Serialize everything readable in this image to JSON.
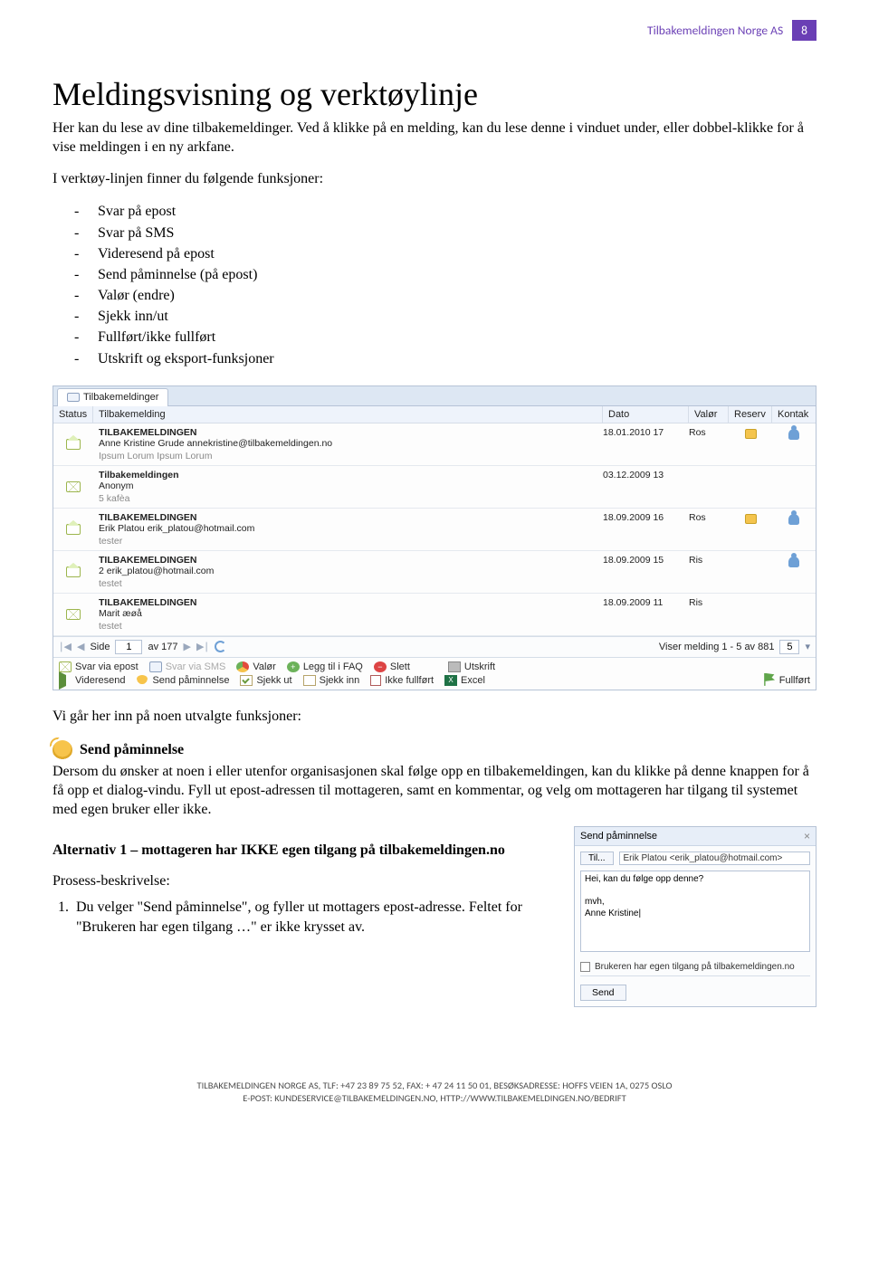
{
  "header": {
    "label": "Tilbakemeldingen Norge AS",
    "page": "8"
  },
  "title": "Meldingsvisning og verktøylinje",
  "intro1": "Her kan du lese av dine tilbakemeldinger. Ved å klikke på en melding, kan du lese denne i vinduet under, eller dobbel-klikke for å vise meldingen i en ny arkfane.",
  "intro2": "I verktøy-linjen finner du følgende funksjoner:",
  "bullets": [
    "Svar på epost",
    "Svar på SMS",
    "Videresend på epost",
    "Send påminnelse (på epost)",
    "Valør (endre)",
    "Sjekk inn/ut",
    "Fullført/ikke fullført",
    "Utskrift og eksport-funksjoner"
  ],
  "app": {
    "tab": "Tilbakemeldinger",
    "columns": {
      "status": "Status",
      "tilbakemelding": "Tilbakemelding",
      "dato": "Dato",
      "valor": "Valør",
      "reserv": "Reserv",
      "kontak": "Kontak"
    },
    "rows": [
      {
        "title": "TILBAKEMELDINGEN",
        "from": "Anne Kristine Grude annekristine@tilbakemeldingen.no",
        "snippet": "Ipsum Lorum Ipsum Lorum",
        "dato": "18.01.2010 17",
        "valor": "Ros",
        "reserv": true,
        "kontak": true,
        "open": true
      },
      {
        "title": "Tilbakemeldingen",
        "from": "Anonym",
        "snippet": "5 kafèa",
        "dato": "03.12.2009 13",
        "valor": "",
        "reserv": false,
        "kontak": false,
        "open": false
      },
      {
        "title": "TILBAKEMELDINGEN",
        "from": "Erik Platou erik_platou@hotmail.com",
        "snippet": "tester",
        "dato": "18.09.2009 16",
        "valor": "Ros",
        "reserv": true,
        "kontak": true,
        "open": true
      },
      {
        "title": "TILBAKEMELDINGEN",
        "from": "2 erik_platou@hotmail.com",
        "snippet": "testet",
        "dato": "18.09.2009 15",
        "valor": "Ris",
        "reserv": false,
        "kontak": true,
        "open": true
      },
      {
        "title": "TILBAKEMELDINGEN",
        "from": "Marit æøå",
        "snippet": "testet",
        "dato": "18.09.2009 11",
        "valor": "Ris",
        "reserv": false,
        "kontak": false,
        "open": false
      }
    ],
    "paging": {
      "side_label": "Side",
      "page": "1",
      "of_label": "av 177",
      "summary": "Viser melding 1 - 5 av 881",
      "pagesize": "5"
    },
    "toolbar": {
      "svar_epost": "Svar via epost",
      "svar_sms": "Svar via SMS",
      "videresend": "Videresend",
      "paminnelse": "Send påminnelse",
      "valor": "Valør",
      "sjekk_ut": "Sjekk ut",
      "sjekk_inn": "Sjekk inn",
      "faq": "Legg til i FAQ",
      "slett": "Slett",
      "ikke_fullfort": "Ikke fullført",
      "utskrift": "Utskrift",
      "excel": "Excel",
      "fullfort": "Fullført"
    }
  },
  "subpara": "Vi går her inn på noen utvalgte funksjoner:",
  "feature": {
    "title": "Send påminnelse",
    "body": "Dersom du ønsker at noen i eller utenfor organisasjonen skal følge opp en tilbakemeldingen, kan du klikke på denne knappen for å få opp et dialog-vindu. Fyll ut epost-adressen til mottageren, samt en kommentar, og velg om mottageren har tilgang til systemet med egen bruker eller ikke."
  },
  "alt": {
    "heading": "Alternativ 1 – mottageren har IKKE egen tilgang på tilbakemeldingen.no",
    "process_label": "Prosess-beskrivelse:",
    "step1": "Du velger \"Send påminnelse\", og fyller ut mottagers epost-adresse. Feltet for \"Brukeren har egen tilgang …\" er ikke krysset av."
  },
  "dialog": {
    "title": "Send påminnelse",
    "til_btn": "Til...",
    "til_value": "Erik Platou <erik_platou@hotmail.com>",
    "body_text": "Hei, kan du følge opp denne?\n\nmvh,\nAnne Kristine|",
    "checkbox_label": "Brukeren har egen tilgang på tilbakemeldingen.no",
    "send": "Send"
  },
  "footer": {
    "line1": "TILBAKEMELDINGEN NORGE AS, TLF: +47 23 89 75 52, FAX: + 47 24 11 50 01, BESØKSADRESSE: HOFFS VEIEN 1A, 0275 OSLO",
    "line2": "E-POST: KUNDESERVICE@TILBAKEMELDINGEN.NO, HTTP://WWW.TILBAKEMELDINGEN.NO/BEDRIFT"
  }
}
